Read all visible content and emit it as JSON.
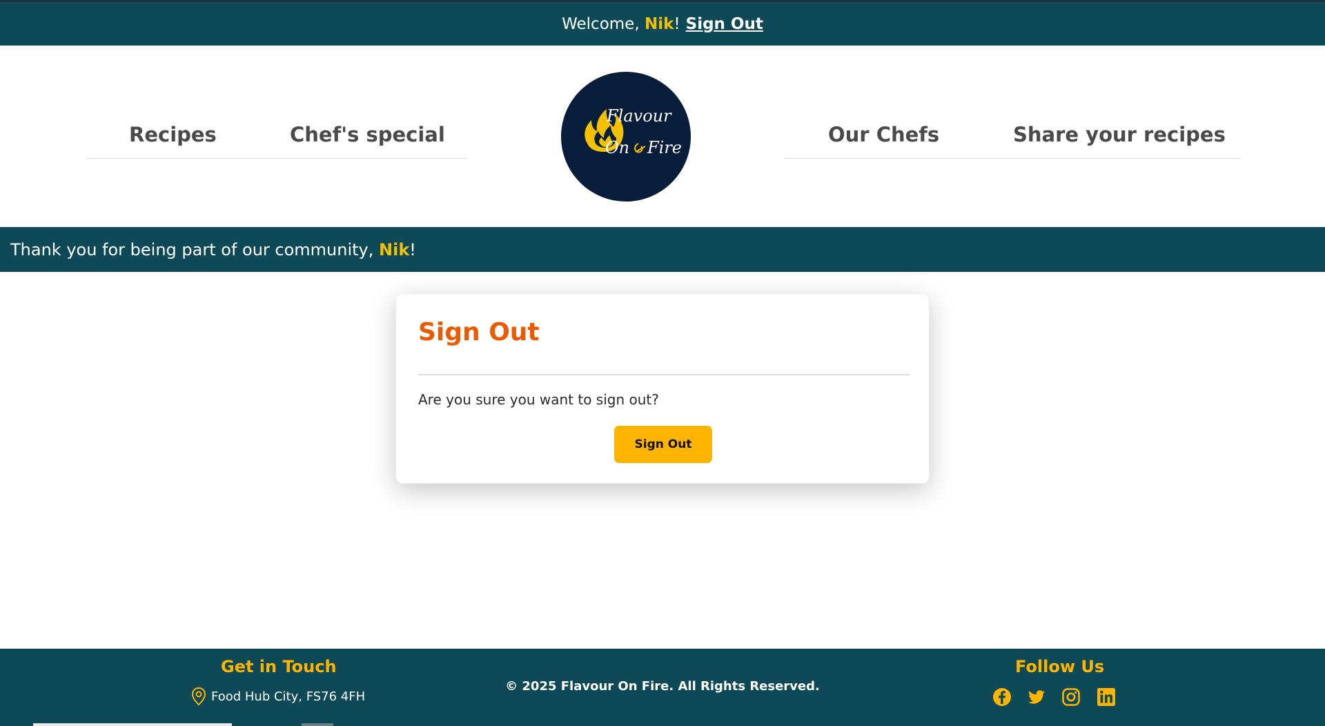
{
  "topbar": {
    "welcome_prefix": "Welcome, ",
    "username": "Nik",
    "exclaim": "!",
    "signout_link": "Sign Out"
  },
  "nav": {
    "left": [
      "Recipes",
      "Chef's special"
    ],
    "right": [
      "Our Chefs",
      "Share your recipes"
    ]
  },
  "logo": {
    "line1": "Flavour",
    "line2": "On",
    "line3": "Fire",
    "icon": "flame-icon"
  },
  "banner": {
    "text": "Thank you for being part of our community, ",
    "username": "Nik",
    "exclaim": "!"
  },
  "card": {
    "title": "Sign Out",
    "message": "Are you sure you want to sign out?",
    "button": "Sign Out"
  },
  "footer": {
    "contact_heading": "Get in Touch",
    "address_icon": "location-pin-icon",
    "address": "Food Hub City, FS76 4FH",
    "copyright": "© 2025 Flavour On Fire. All Rights Reserved.",
    "follow_heading": "Follow Us",
    "social_icons": [
      "facebook-icon",
      "twitter-icon",
      "instagram-icon",
      "linkedin-icon"
    ]
  },
  "colors": {
    "teal": "#0e4957",
    "accent_yellow": "#ffb400",
    "title_orange": "#ea5a00",
    "logo_navy": "#071d3a"
  }
}
